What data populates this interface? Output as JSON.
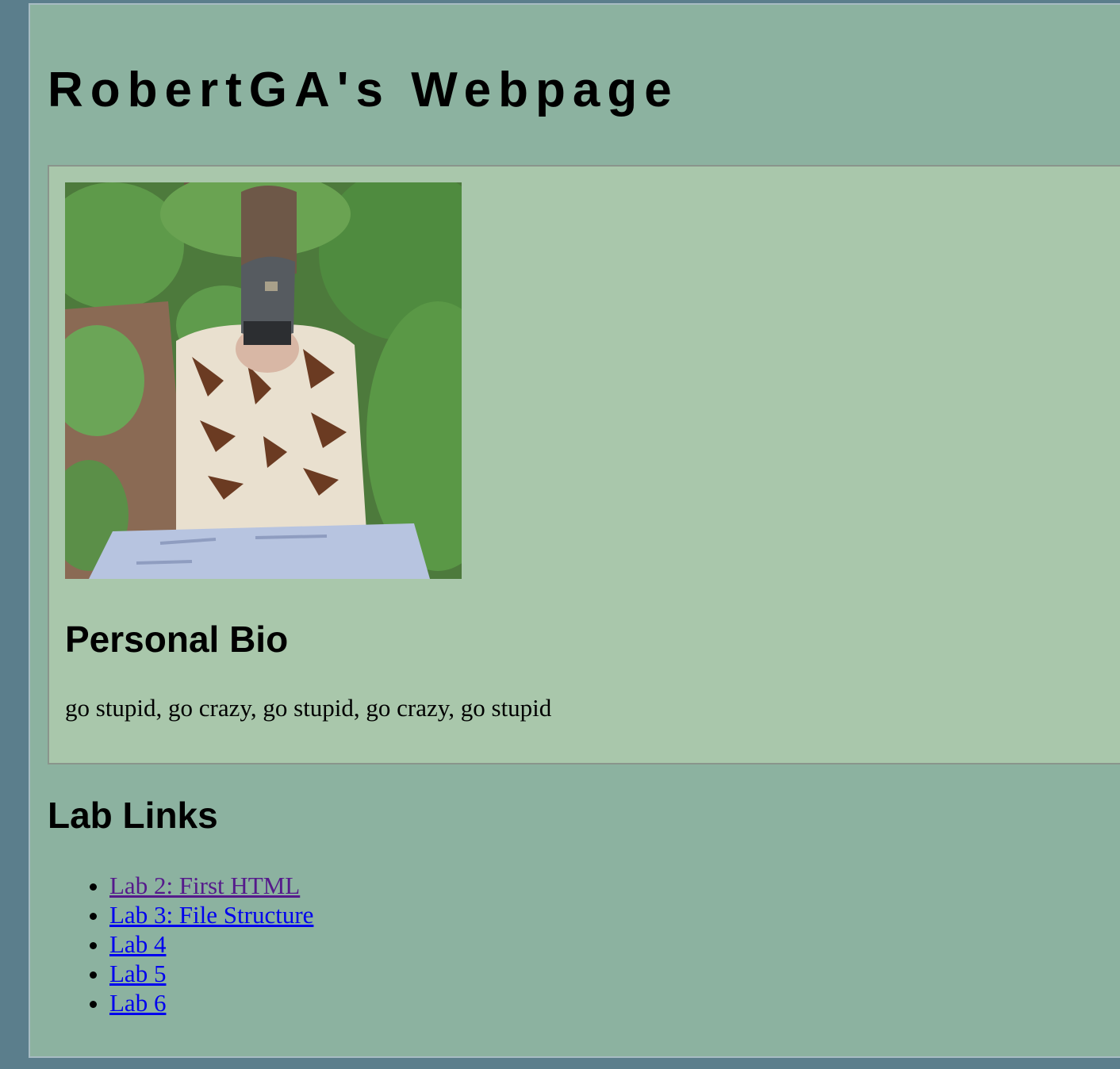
{
  "header": {
    "title": "RobertGA's Webpage"
  },
  "bio": {
    "photo_alt": "photo",
    "heading": "Personal Bio",
    "text": "go stupid, go crazy, go stupid, go crazy, go stupid"
  },
  "lab_links": {
    "heading": "Lab Links",
    "items": [
      {
        "label": "Lab 2: First HTML",
        "visited": true
      },
      {
        "label": "Lab 3: File Structure",
        "visited": false
      },
      {
        "label": "Lab 4",
        "visited": false
      },
      {
        "label": "Lab 5",
        "visited": false
      },
      {
        "label": "Lab 6",
        "visited": false
      }
    ]
  },
  "colors": {
    "outer_background": "#5b7e8c",
    "page_background": "#8cb2a0",
    "card_background": "#a9c7ab",
    "link": "#0000ee",
    "visited_link": "#551a8b"
  }
}
